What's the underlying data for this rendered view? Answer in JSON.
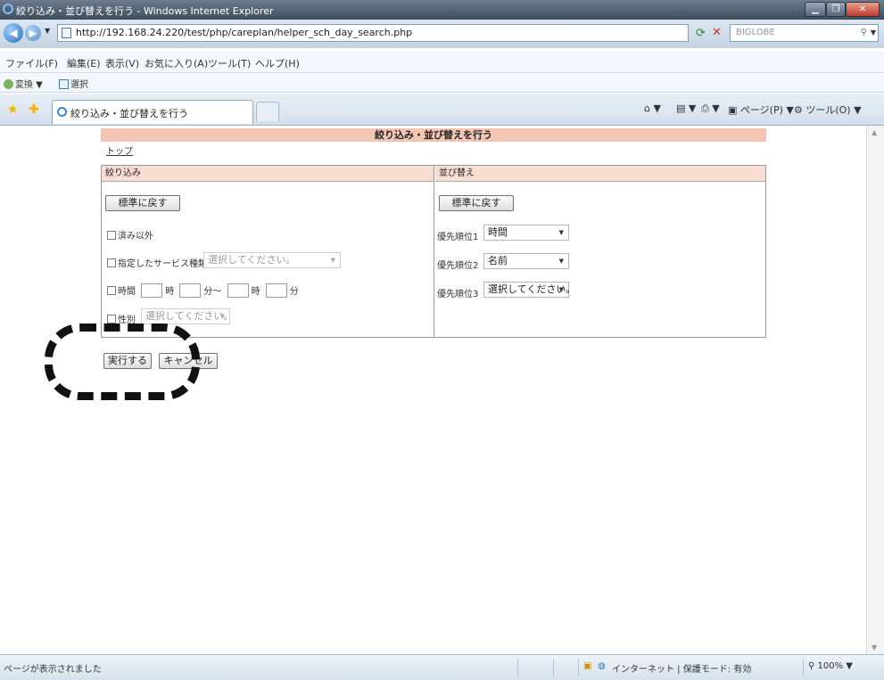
{
  "window": {
    "title": "絞り込み・並び替えを行う - Windows Internet Explorer",
    "min": "▁",
    "max": "❐",
    "close": "✕"
  },
  "address_bar": {
    "url": "http://192.168.24.220/test/php/careplan/helper_sch_day_search.php",
    "search_text": "BIGLOBE"
  },
  "menu": [
    "ファイル(F)",
    "編集(E)",
    "表示(V)",
    "お気に入り(A)",
    "ツール(T)",
    "ヘルプ(H)"
  ],
  "toolbar2": {
    "convert": "変換",
    "select": "選択"
  },
  "tabs": {
    "active_label": "絞り込み・並び替えを行う"
  },
  "command_bar": {
    "page": "ページ(P)",
    "tools": "ツール(O)"
  },
  "page": {
    "title": "絞り込み・並び替えを行う",
    "top_link": "トップ",
    "filter": {
      "header": "絞り込み",
      "reset_button": "標準に戻す",
      "exclude_done": "済み以外",
      "service_type_label": "指定したサービス種類",
      "service_type_select": "選択してください。",
      "time_label": "時間",
      "hour": "時",
      "minute_from": "分～",
      "hour2": "時",
      "minute_to": "分",
      "gender_label": "性別",
      "gender_select": "選択してください。"
    },
    "sort": {
      "header": "並び替え",
      "reset_button": "標準に戻す",
      "priority1_label": "優先順位1",
      "priority1_value": "時間",
      "priority2_label": "優先順位2",
      "priority2_value": "名前",
      "priority3_label": "優先順位3",
      "priority3_value": "選択してください。"
    },
    "execute_button": "実行する",
    "cancel_button": "キャンセル"
  },
  "status_bar": {
    "message": "ページが表示されました",
    "zone": "インターネット | 保護モード: 有効",
    "zoom": "100%"
  },
  "colors": {
    "title_bg": "#f3c5b2",
    "panel_header_bg": "#f8ddd3"
  }
}
